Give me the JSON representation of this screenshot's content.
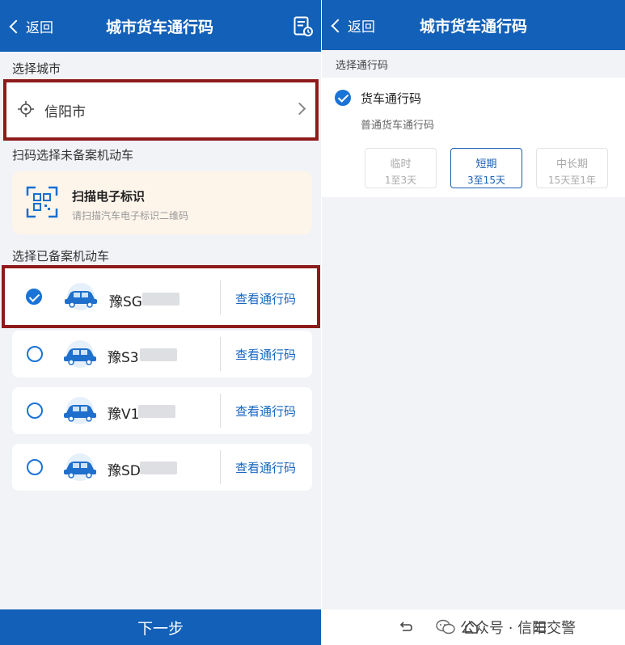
{
  "left": {
    "header": {
      "back_label": "返回",
      "title": "城市货车通行码",
      "doc_icon": "document-settings-icon"
    },
    "city_section": {
      "label": "选择城市",
      "city_name": "信阳市"
    },
    "scan_section": {
      "label": "扫码选择未备案机动车",
      "title": "扫描电子标识",
      "subtitle": "请扫描汽车电子标识二维码"
    },
    "vehicle_section": {
      "label": "选择已备案机动车",
      "view_label": "查看通行码",
      "vehicles": [
        {
          "plate": "豫SG",
          "selected": true
        },
        {
          "plate": "豫S3",
          "selected": false
        },
        {
          "plate": "豫V1",
          "selected": false
        },
        {
          "plate": "豫SD",
          "selected": false
        }
      ]
    },
    "next_button": "下一步"
  },
  "right": {
    "header": {
      "back_label": "返回",
      "title": "城市货车通行码"
    },
    "pass_label": "选择通行码",
    "pass": {
      "title": "货车通行码",
      "subtitle": "普通货车通行码"
    },
    "durations": [
      {
        "name": "临时",
        "range": "1至3天",
        "active": false
      },
      {
        "name": "短期",
        "range": "3至15天",
        "active": true
      },
      {
        "name": "中长期",
        "range": "15天至1年",
        "active": false
      }
    ],
    "watermark": "公众号 · 信阳交警"
  },
  "colors": {
    "brand_blue": "#1260b8",
    "highlight_red": "#8e1a1a",
    "check_blue": "#1a73d6",
    "scan_card_bg": "#fdf4ea"
  }
}
